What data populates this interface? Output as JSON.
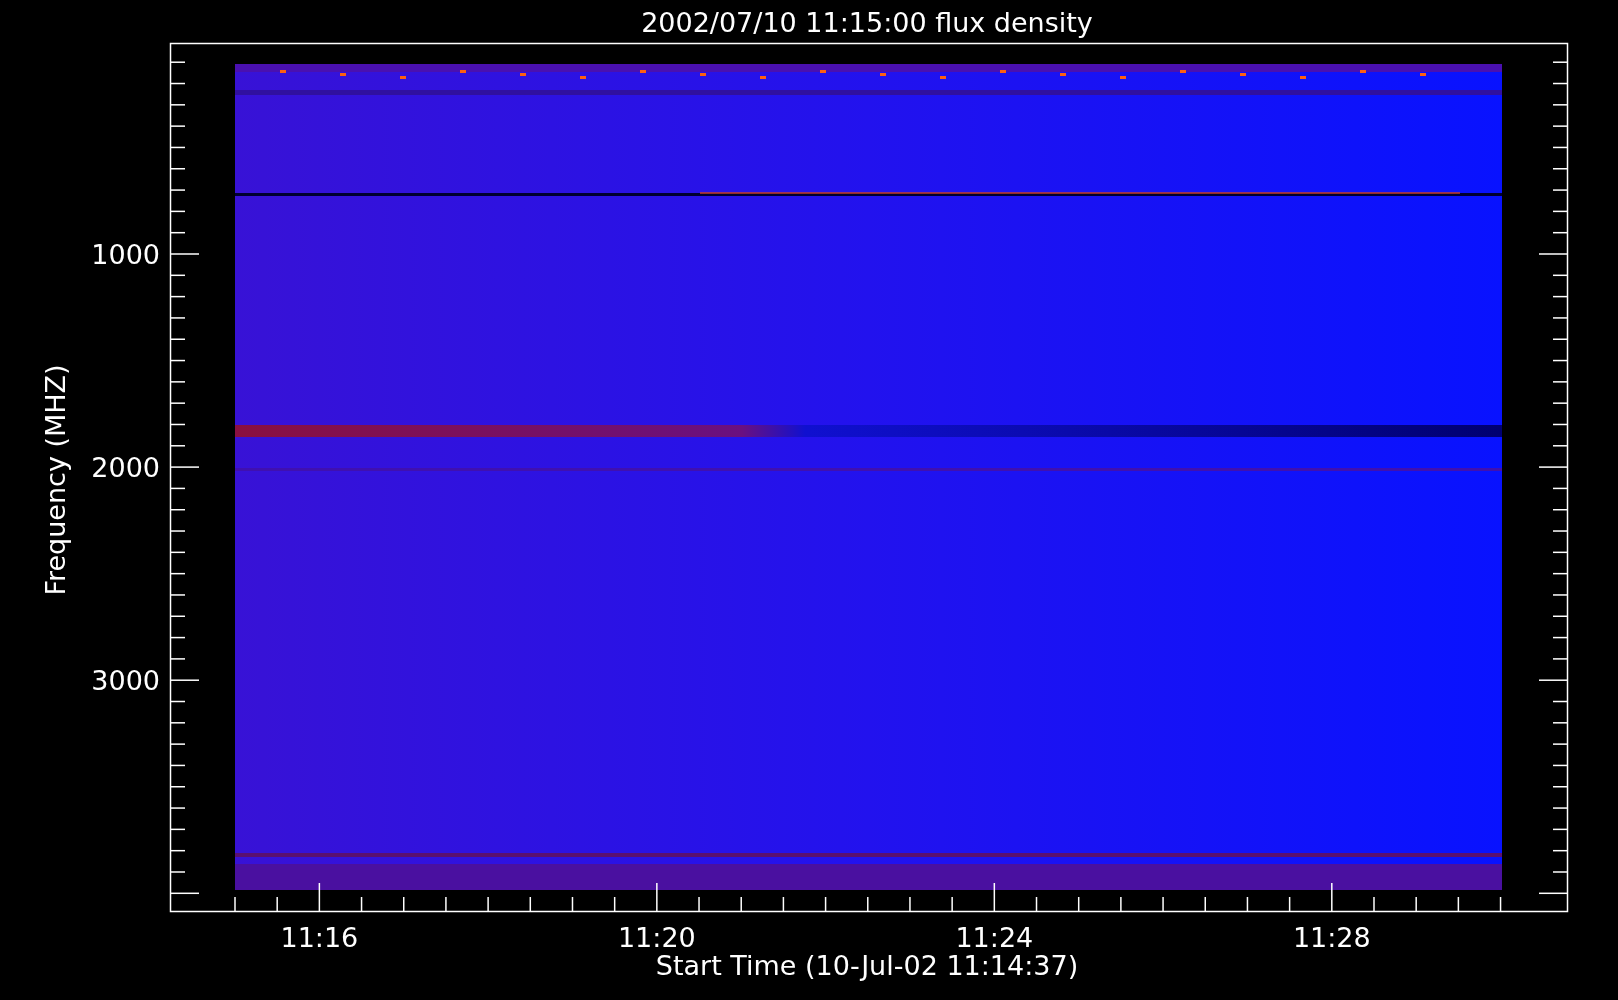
{
  "title": "2002/07/10 11:15:00 flux density",
  "y_axis": {
    "label": "Frequency (MHZ)",
    "ticks": [
      "1000",
      "2000",
      "3000"
    ]
  },
  "x_axis": {
    "label": "Start Time (10-Jul-02 11:14:37)",
    "ticks": [
      "11:16",
      "11:20",
      "11:24",
      "11:28"
    ]
  }
}
